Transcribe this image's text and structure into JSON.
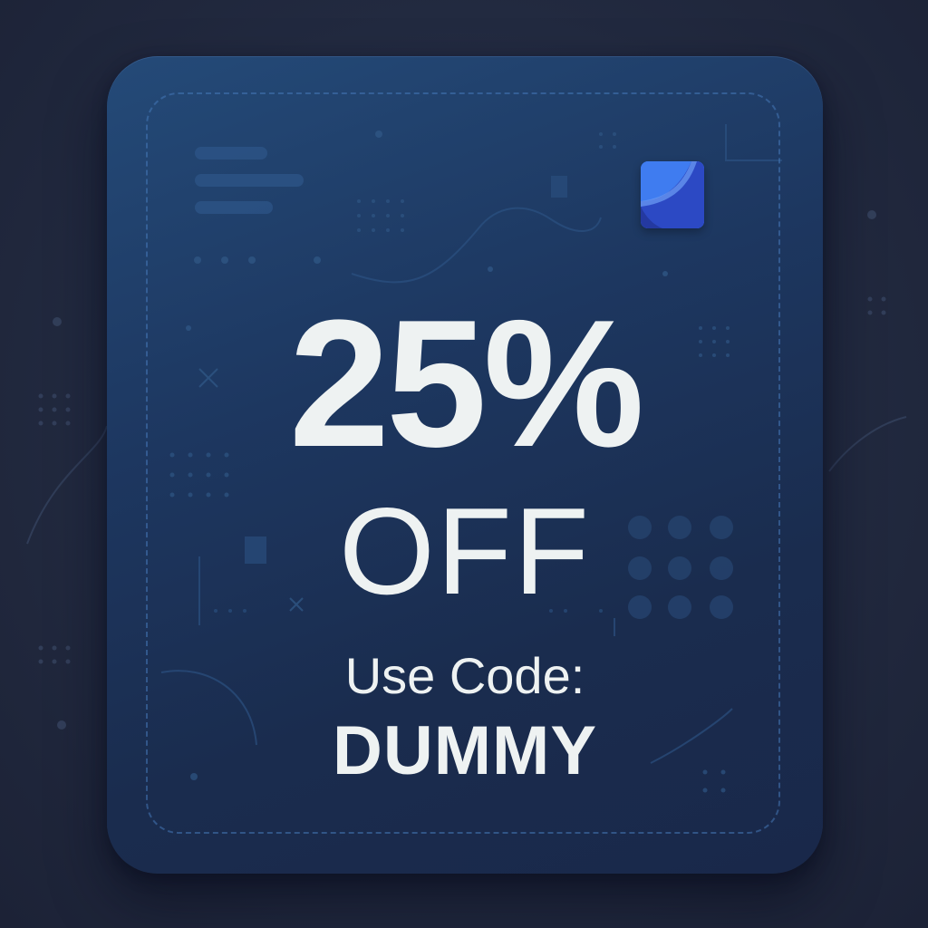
{
  "coupon": {
    "discount": "25%",
    "off_label": "OFF",
    "code_prompt": "Use Code:",
    "code": "DUMMY"
  },
  "logo": {
    "icon": "brand-logo-icon",
    "colors": [
      "#2f67e0",
      "#2c4fc8",
      "#5b8ff5"
    ]
  },
  "colors": {
    "background": "#222a40",
    "card": "#1d3760",
    "text": "#eef2f2",
    "dashed_border": "#4678b9"
  }
}
